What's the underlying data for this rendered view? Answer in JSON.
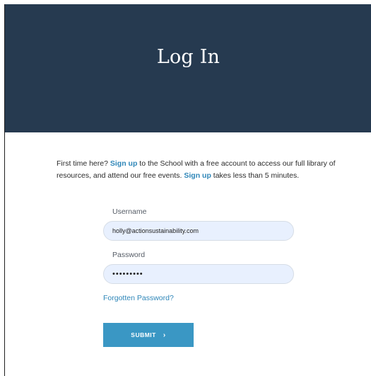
{
  "hero": {
    "title": "Log In",
    "background": "#263a50"
  },
  "intro": {
    "part1": "First time here? ",
    "link1": "Sign up",
    "part2": " to the School with a free account to access our full library of resources, and attend our free events. ",
    "link2": "Sign up",
    "part3": " takes less than 5 minutes."
  },
  "form": {
    "username_label": "Username",
    "username_value": "holly@actionsustainability.com",
    "password_label": "Password",
    "password_value": "password1",
    "forgot_label": "Forgotten Password?",
    "submit_label": "SUBMIT",
    "submit_icon": "chevron-right-icon",
    "accent": "#3a97c4",
    "link_color": "#2e86b8"
  }
}
